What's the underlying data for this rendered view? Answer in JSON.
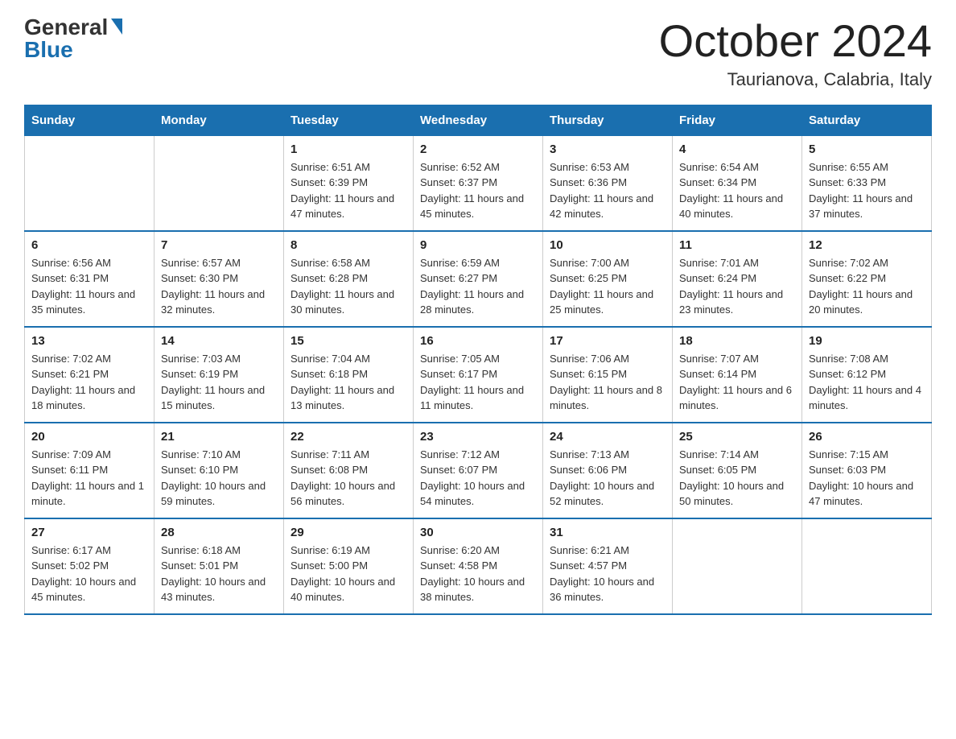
{
  "logo": {
    "general": "General",
    "blue": "Blue"
  },
  "title": "October 2024",
  "subtitle": "Taurianova, Calabria, Italy",
  "days_header": [
    "Sunday",
    "Monday",
    "Tuesday",
    "Wednesday",
    "Thursday",
    "Friday",
    "Saturday"
  ],
  "weeks": [
    [
      {
        "day": "",
        "sunrise": "",
        "sunset": "",
        "daylight": ""
      },
      {
        "day": "",
        "sunrise": "",
        "sunset": "",
        "daylight": ""
      },
      {
        "day": "1",
        "sunrise": "Sunrise: 6:51 AM",
        "sunset": "Sunset: 6:39 PM",
        "daylight": "Daylight: 11 hours and 47 minutes."
      },
      {
        "day": "2",
        "sunrise": "Sunrise: 6:52 AM",
        "sunset": "Sunset: 6:37 PM",
        "daylight": "Daylight: 11 hours and 45 minutes."
      },
      {
        "day": "3",
        "sunrise": "Sunrise: 6:53 AM",
        "sunset": "Sunset: 6:36 PM",
        "daylight": "Daylight: 11 hours and 42 minutes."
      },
      {
        "day": "4",
        "sunrise": "Sunrise: 6:54 AM",
        "sunset": "Sunset: 6:34 PM",
        "daylight": "Daylight: 11 hours and 40 minutes."
      },
      {
        "day": "5",
        "sunrise": "Sunrise: 6:55 AM",
        "sunset": "Sunset: 6:33 PM",
        "daylight": "Daylight: 11 hours and 37 minutes."
      }
    ],
    [
      {
        "day": "6",
        "sunrise": "Sunrise: 6:56 AM",
        "sunset": "Sunset: 6:31 PM",
        "daylight": "Daylight: 11 hours and 35 minutes."
      },
      {
        "day": "7",
        "sunrise": "Sunrise: 6:57 AM",
        "sunset": "Sunset: 6:30 PM",
        "daylight": "Daylight: 11 hours and 32 minutes."
      },
      {
        "day": "8",
        "sunrise": "Sunrise: 6:58 AM",
        "sunset": "Sunset: 6:28 PM",
        "daylight": "Daylight: 11 hours and 30 minutes."
      },
      {
        "day": "9",
        "sunrise": "Sunrise: 6:59 AM",
        "sunset": "Sunset: 6:27 PM",
        "daylight": "Daylight: 11 hours and 28 minutes."
      },
      {
        "day": "10",
        "sunrise": "Sunrise: 7:00 AM",
        "sunset": "Sunset: 6:25 PM",
        "daylight": "Daylight: 11 hours and 25 minutes."
      },
      {
        "day": "11",
        "sunrise": "Sunrise: 7:01 AM",
        "sunset": "Sunset: 6:24 PM",
        "daylight": "Daylight: 11 hours and 23 minutes."
      },
      {
        "day": "12",
        "sunrise": "Sunrise: 7:02 AM",
        "sunset": "Sunset: 6:22 PM",
        "daylight": "Daylight: 11 hours and 20 minutes."
      }
    ],
    [
      {
        "day": "13",
        "sunrise": "Sunrise: 7:02 AM",
        "sunset": "Sunset: 6:21 PM",
        "daylight": "Daylight: 11 hours and 18 minutes."
      },
      {
        "day": "14",
        "sunrise": "Sunrise: 7:03 AM",
        "sunset": "Sunset: 6:19 PM",
        "daylight": "Daylight: 11 hours and 15 minutes."
      },
      {
        "day": "15",
        "sunrise": "Sunrise: 7:04 AM",
        "sunset": "Sunset: 6:18 PM",
        "daylight": "Daylight: 11 hours and 13 minutes."
      },
      {
        "day": "16",
        "sunrise": "Sunrise: 7:05 AM",
        "sunset": "Sunset: 6:17 PM",
        "daylight": "Daylight: 11 hours and 11 minutes."
      },
      {
        "day": "17",
        "sunrise": "Sunrise: 7:06 AM",
        "sunset": "Sunset: 6:15 PM",
        "daylight": "Daylight: 11 hours and 8 minutes."
      },
      {
        "day": "18",
        "sunrise": "Sunrise: 7:07 AM",
        "sunset": "Sunset: 6:14 PM",
        "daylight": "Daylight: 11 hours and 6 minutes."
      },
      {
        "day": "19",
        "sunrise": "Sunrise: 7:08 AM",
        "sunset": "Sunset: 6:12 PM",
        "daylight": "Daylight: 11 hours and 4 minutes."
      }
    ],
    [
      {
        "day": "20",
        "sunrise": "Sunrise: 7:09 AM",
        "sunset": "Sunset: 6:11 PM",
        "daylight": "Daylight: 11 hours and 1 minute."
      },
      {
        "day": "21",
        "sunrise": "Sunrise: 7:10 AM",
        "sunset": "Sunset: 6:10 PM",
        "daylight": "Daylight: 10 hours and 59 minutes."
      },
      {
        "day": "22",
        "sunrise": "Sunrise: 7:11 AM",
        "sunset": "Sunset: 6:08 PM",
        "daylight": "Daylight: 10 hours and 56 minutes."
      },
      {
        "day": "23",
        "sunrise": "Sunrise: 7:12 AM",
        "sunset": "Sunset: 6:07 PM",
        "daylight": "Daylight: 10 hours and 54 minutes."
      },
      {
        "day": "24",
        "sunrise": "Sunrise: 7:13 AM",
        "sunset": "Sunset: 6:06 PM",
        "daylight": "Daylight: 10 hours and 52 minutes."
      },
      {
        "day": "25",
        "sunrise": "Sunrise: 7:14 AM",
        "sunset": "Sunset: 6:05 PM",
        "daylight": "Daylight: 10 hours and 50 minutes."
      },
      {
        "day": "26",
        "sunrise": "Sunrise: 7:15 AM",
        "sunset": "Sunset: 6:03 PM",
        "daylight": "Daylight: 10 hours and 47 minutes."
      }
    ],
    [
      {
        "day": "27",
        "sunrise": "Sunrise: 6:17 AM",
        "sunset": "Sunset: 5:02 PM",
        "daylight": "Daylight: 10 hours and 45 minutes."
      },
      {
        "day": "28",
        "sunrise": "Sunrise: 6:18 AM",
        "sunset": "Sunset: 5:01 PM",
        "daylight": "Daylight: 10 hours and 43 minutes."
      },
      {
        "day": "29",
        "sunrise": "Sunrise: 6:19 AM",
        "sunset": "Sunset: 5:00 PM",
        "daylight": "Daylight: 10 hours and 40 minutes."
      },
      {
        "day": "30",
        "sunrise": "Sunrise: 6:20 AM",
        "sunset": "Sunset: 4:58 PM",
        "daylight": "Daylight: 10 hours and 38 minutes."
      },
      {
        "day": "31",
        "sunrise": "Sunrise: 6:21 AM",
        "sunset": "Sunset: 4:57 PM",
        "daylight": "Daylight: 10 hours and 36 minutes."
      },
      {
        "day": "",
        "sunrise": "",
        "sunset": "",
        "daylight": ""
      },
      {
        "day": "",
        "sunrise": "",
        "sunset": "",
        "daylight": ""
      }
    ]
  ]
}
